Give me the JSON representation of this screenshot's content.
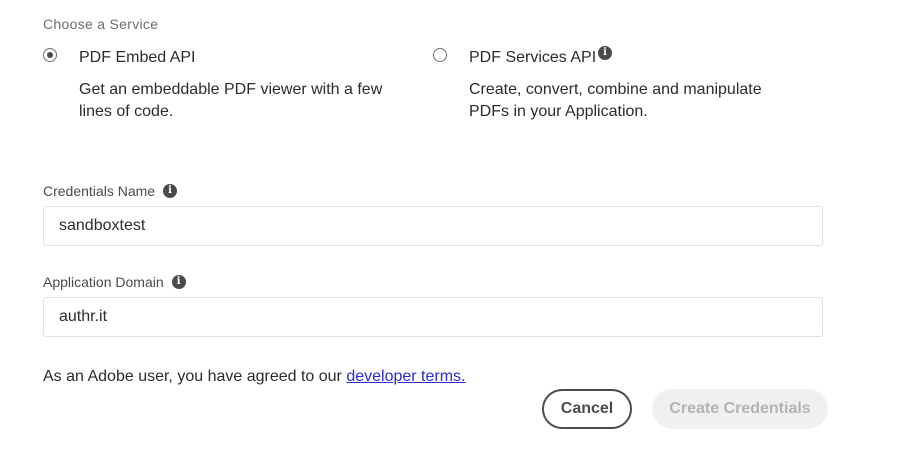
{
  "section_label": "Choose a Service",
  "services": [
    {
      "title": "PDF Embed API",
      "description": "Get an embeddable PDF viewer with a few lines of code.",
      "selected": true,
      "has_info": false
    },
    {
      "title": "PDF Services API",
      "description": "Create, convert, combine and manipulate PDFs in your Application.",
      "selected": false,
      "has_info": true
    }
  ],
  "credentials_name": {
    "label": "Credentials Name",
    "value": "sandboxtest"
  },
  "application_domain": {
    "label": "Application Domain",
    "value": "authr.it"
  },
  "terms": {
    "text": "As an Adobe user, you have agreed to our ",
    "link_text": "developer terms."
  },
  "actions": {
    "cancel_label": "Cancel",
    "create_label": "Create Credentials",
    "create_disabled": true
  },
  "icons": {
    "info": "info-icon"
  }
}
